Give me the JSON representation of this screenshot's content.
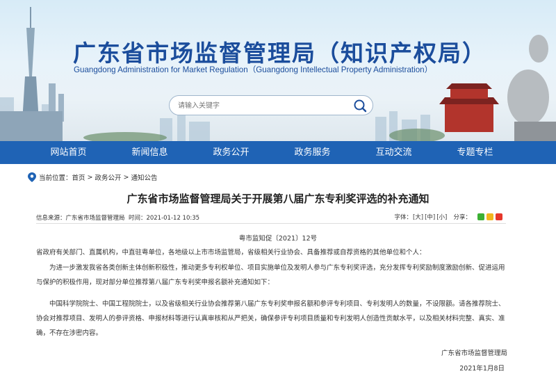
{
  "header": {
    "title": "广东省市场监督管理局（知识产权局）",
    "subtitle": "Guangdong Administration for Market Regulation（Guangdong Intellectual Property Administration）"
  },
  "search": {
    "placeholder": "请输入关键字",
    "button_icon": "search-icon"
  },
  "nav": {
    "items": [
      {
        "label": "网站首页"
      },
      {
        "label": "新闻信息"
      },
      {
        "label": "政务公开"
      },
      {
        "label": "政务服务"
      },
      {
        "label": "互动交流"
      },
      {
        "label": "专题专栏"
      }
    ]
  },
  "breadcrumb": {
    "prefix": "当前位置：",
    "items": [
      "首页",
      "政务公开",
      "通知公告"
    ],
    "separator": ">"
  },
  "article": {
    "title": "广东省市场监督管理局关于开展第八届广东专利奖评选的补充通知",
    "meta_source_label": "信息来源：",
    "meta_source": "广东省市场监督管理局",
    "meta_time_label": "时间：",
    "meta_time": "2021-01-12 10:35",
    "font_size_label": "字体：",
    "font_sizes": [
      "[大]",
      "[中]",
      "[小]"
    ],
    "share_label": "分享：",
    "doc_number": "粤市监知促〔2021〕12号",
    "salutation": "省政府有关部门、直属机构，中直驻粤单位，各地级以上市市场监管局，省级相关行业协会、具备推荐或自荐资格的其他单位和个人：",
    "paragraph1": "为进一步激发我省各类创新主体创新积极性，推动更多专利权单位、项目实施单位及发明人参与广东专利奖评选，充分发挥专利奖励制度激励创新、促进运用与保护的积极作用，现对部分单位推荐第八届广东专利奖申报名额补充通知如下：",
    "paragraph2": "中国科学院院士、中国工程院院士，以及省级相关行业协会推荐第八届广东专利奖申报名额和参评专利项目、专利发明人的数量，不设限额。请各推荐院士、协会对推荐项目、发明人的参评资格、申报材料等进行认真审核和从严把关，确保参评专利项目质量和专利发明人创造性贡献水平，以及相关材料完整、真实、准确，不存在涉密内容。",
    "signature": "广东省市场监督管理局",
    "date": "2021年1月8日"
  },
  "colors": {
    "brand_blue": "#1b4d9c",
    "nav_blue": "#1f63b5"
  }
}
